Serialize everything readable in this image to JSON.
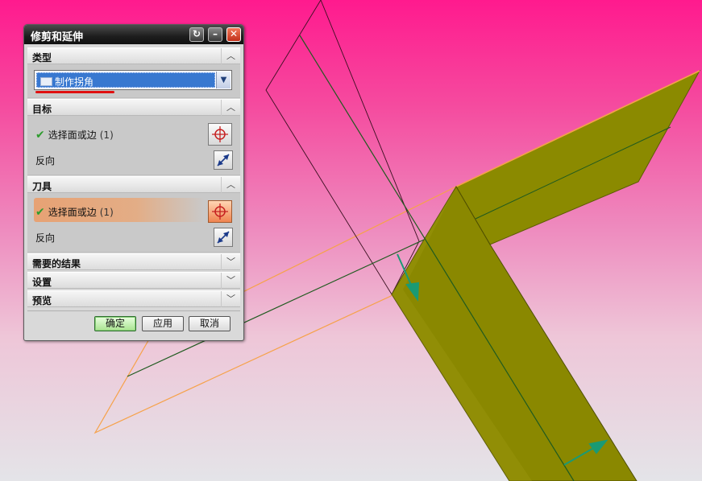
{
  "dialog": {
    "title": "修剪和延伸",
    "type_group": {
      "label": "类型",
      "selected": "制作拐角"
    },
    "target_group": {
      "label": "目标",
      "select_label": "选择面或边",
      "select_count": "(1)",
      "reverse_label": "反向"
    },
    "tool_group": {
      "label": "刀具",
      "select_label": "选择面或边",
      "select_count": "(1)",
      "reverse_label": "反向"
    },
    "collapsed_groups": [
      "需要的结果",
      "设置",
      "预览"
    ],
    "buttons": {
      "ok": "确定",
      "apply": "应用",
      "cancel": "取消"
    }
  },
  "colors": {
    "face_fill": "#8b8a00",
    "target_highlight": "#f6a24a",
    "edge_dark_green": "#1f5a1f",
    "arrow_teal": "#1a9a74"
  },
  "icons": [
    "reset-icon",
    "minimize-icon",
    "close-icon",
    "chevron-up-icon",
    "chevron-down-icon",
    "crosshair-select-icon",
    "reverse-direction-icon",
    "checkmark-icon",
    "dropdown-arrow-icon"
  ]
}
